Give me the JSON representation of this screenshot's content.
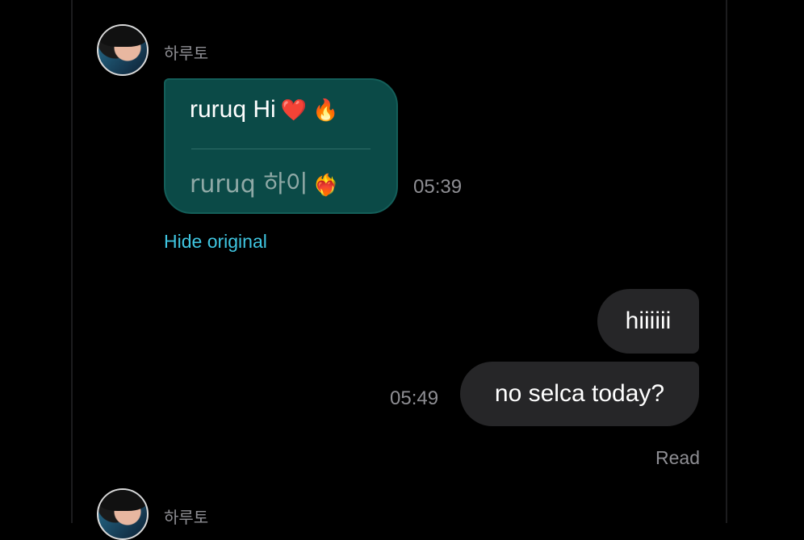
{
  "sender": {
    "name": "하루토"
  },
  "incoming_message": {
    "translated_text": "ruruq Hi",
    "translated_emojis": "❤️ 🔥",
    "original_text": "ruruq 하이",
    "original_emoji": "❤️‍🔥",
    "time": "05:39",
    "hide_original_label": "Hide original"
  },
  "outgoing_messages": [
    {
      "text": "hiiiiii"
    },
    {
      "text": "no selca today?",
      "time": "05:49"
    }
  ],
  "read_receipt": "Read",
  "next_sender": {
    "name": "하루토"
  },
  "colors": {
    "background": "#000000",
    "incoming_bubble": "#0b4a47",
    "outgoing_bubble": "#262628",
    "link_accent": "#3fc5e0",
    "meta_text": "#8e8e93"
  }
}
